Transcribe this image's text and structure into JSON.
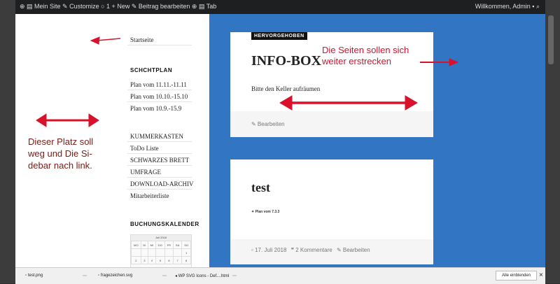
{
  "admin_bar": {
    "left_text": "⊕  ▤ Mein Site  ✎ Customize  ○ 1  + New  ✎ Beitrag bearbeiten ⊕  ▤ Tab",
    "right_text": "Willkommen, Admin ▪  ⌕"
  },
  "sidebar": {
    "menu_item": "Startseite",
    "section_title": "SCHCHTPLAN",
    "plans": [
      "Plan vom 11.11.-11.11",
      "Plan vom 10.10.-15.10",
      "Plan vom 10.9.-15.9"
    ],
    "links": [
      "KUMMERKASTEN",
      "ToDo Liste",
      "SCHWARZES BRETT",
      "UMFRAGE",
      "DOWNLOAD-ARCHIV",
      "Mitarbeiterliste"
    ],
    "calendar_title": "BUCHUNGSKALENDER",
    "calendar": {
      "month": "Juli 2018",
      "days": [
        "MO",
        "DI",
        "MI",
        "DO",
        "FR",
        "SA",
        "SO"
      ],
      "row1": [
        "",
        "",
        "",
        "",
        "",
        "",
        "1"
      ],
      "row2": [
        "2",
        "3",
        "4",
        "5",
        "6",
        "7",
        "8"
      ]
    }
  },
  "post1": {
    "badge": "HERVORGEHOBEN",
    "title": "INFO-BOX",
    "text": "Bitte den Keller aufräumen",
    "edit": "✎ Bearbeiten"
  },
  "post2": {
    "title": "test",
    "attachment": "Plan vom 7.3.3",
    "date": "17. Juli 2018",
    "comments": "2 Kommentare",
    "edit": "Bearbeiten"
  },
  "annotations": {
    "right_line1": "Die Seiten sollen sich",
    "right_line2": "weiter erstrecken",
    "left_line1": "Dieser Platz soll",
    "left_line2": "weg und  Die Si-",
    "left_line3": "debar nach link."
  },
  "taskbar": {
    "file1": "test.png",
    "file2": "fragezeichen.svg",
    "file3": "WP SVG Icons - Def....html",
    "show_all": "Alle einblenden",
    "close": "×"
  },
  "colors": {
    "content_bg": "#3276c3",
    "annotation_red": "#d9112b",
    "annotation_dark": "#7a1a14"
  }
}
